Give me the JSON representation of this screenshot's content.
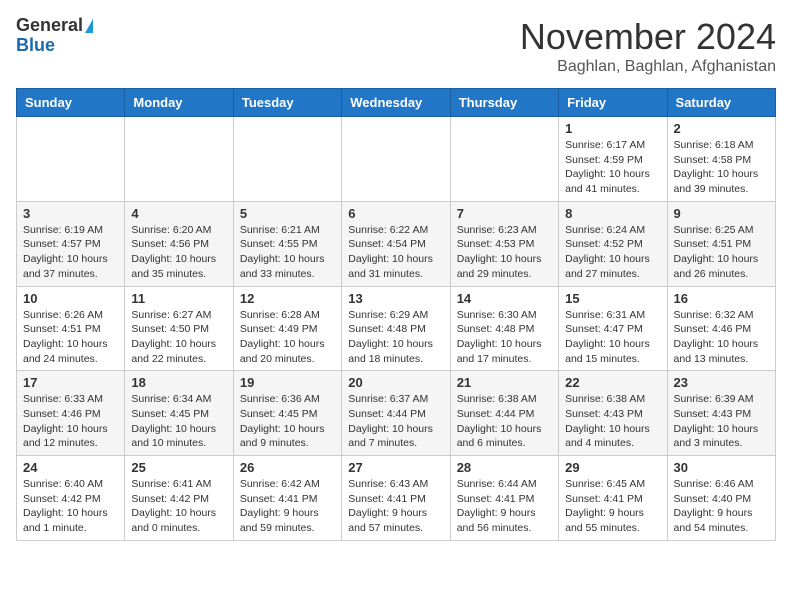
{
  "header": {
    "logo_general": "General",
    "logo_blue": "Blue",
    "month_title": "November 2024",
    "location": "Baghlan, Baghlan, Afghanistan"
  },
  "weekdays": [
    "Sunday",
    "Monday",
    "Tuesday",
    "Wednesday",
    "Thursday",
    "Friday",
    "Saturday"
  ],
  "weeks": [
    [
      {
        "day": "",
        "info": ""
      },
      {
        "day": "",
        "info": ""
      },
      {
        "day": "",
        "info": ""
      },
      {
        "day": "",
        "info": ""
      },
      {
        "day": "",
        "info": ""
      },
      {
        "day": "1",
        "info": "Sunrise: 6:17 AM\nSunset: 4:59 PM\nDaylight: 10 hours and 41 minutes."
      },
      {
        "day": "2",
        "info": "Sunrise: 6:18 AM\nSunset: 4:58 PM\nDaylight: 10 hours and 39 minutes."
      }
    ],
    [
      {
        "day": "3",
        "info": "Sunrise: 6:19 AM\nSunset: 4:57 PM\nDaylight: 10 hours and 37 minutes."
      },
      {
        "day": "4",
        "info": "Sunrise: 6:20 AM\nSunset: 4:56 PM\nDaylight: 10 hours and 35 minutes."
      },
      {
        "day": "5",
        "info": "Sunrise: 6:21 AM\nSunset: 4:55 PM\nDaylight: 10 hours and 33 minutes."
      },
      {
        "day": "6",
        "info": "Sunrise: 6:22 AM\nSunset: 4:54 PM\nDaylight: 10 hours and 31 minutes."
      },
      {
        "day": "7",
        "info": "Sunrise: 6:23 AM\nSunset: 4:53 PM\nDaylight: 10 hours and 29 minutes."
      },
      {
        "day": "8",
        "info": "Sunrise: 6:24 AM\nSunset: 4:52 PM\nDaylight: 10 hours and 27 minutes."
      },
      {
        "day": "9",
        "info": "Sunrise: 6:25 AM\nSunset: 4:51 PM\nDaylight: 10 hours and 26 minutes."
      }
    ],
    [
      {
        "day": "10",
        "info": "Sunrise: 6:26 AM\nSunset: 4:51 PM\nDaylight: 10 hours and 24 minutes."
      },
      {
        "day": "11",
        "info": "Sunrise: 6:27 AM\nSunset: 4:50 PM\nDaylight: 10 hours and 22 minutes."
      },
      {
        "day": "12",
        "info": "Sunrise: 6:28 AM\nSunset: 4:49 PM\nDaylight: 10 hours and 20 minutes."
      },
      {
        "day": "13",
        "info": "Sunrise: 6:29 AM\nSunset: 4:48 PM\nDaylight: 10 hours and 18 minutes."
      },
      {
        "day": "14",
        "info": "Sunrise: 6:30 AM\nSunset: 4:48 PM\nDaylight: 10 hours and 17 minutes."
      },
      {
        "day": "15",
        "info": "Sunrise: 6:31 AM\nSunset: 4:47 PM\nDaylight: 10 hours and 15 minutes."
      },
      {
        "day": "16",
        "info": "Sunrise: 6:32 AM\nSunset: 4:46 PM\nDaylight: 10 hours and 13 minutes."
      }
    ],
    [
      {
        "day": "17",
        "info": "Sunrise: 6:33 AM\nSunset: 4:46 PM\nDaylight: 10 hours and 12 minutes."
      },
      {
        "day": "18",
        "info": "Sunrise: 6:34 AM\nSunset: 4:45 PM\nDaylight: 10 hours and 10 minutes."
      },
      {
        "day": "19",
        "info": "Sunrise: 6:36 AM\nSunset: 4:45 PM\nDaylight: 10 hours and 9 minutes."
      },
      {
        "day": "20",
        "info": "Sunrise: 6:37 AM\nSunset: 4:44 PM\nDaylight: 10 hours and 7 minutes."
      },
      {
        "day": "21",
        "info": "Sunrise: 6:38 AM\nSunset: 4:44 PM\nDaylight: 10 hours and 6 minutes."
      },
      {
        "day": "22",
        "info": "Sunrise: 6:38 AM\nSunset: 4:43 PM\nDaylight: 10 hours and 4 minutes."
      },
      {
        "day": "23",
        "info": "Sunrise: 6:39 AM\nSunset: 4:43 PM\nDaylight: 10 hours and 3 minutes."
      }
    ],
    [
      {
        "day": "24",
        "info": "Sunrise: 6:40 AM\nSunset: 4:42 PM\nDaylight: 10 hours and 1 minute."
      },
      {
        "day": "25",
        "info": "Sunrise: 6:41 AM\nSunset: 4:42 PM\nDaylight: 10 hours and 0 minutes."
      },
      {
        "day": "26",
        "info": "Sunrise: 6:42 AM\nSunset: 4:41 PM\nDaylight: 9 hours and 59 minutes."
      },
      {
        "day": "27",
        "info": "Sunrise: 6:43 AM\nSunset: 4:41 PM\nDaylight: 9 hours and 57 minutes."
      },
      {
        "day": "28",
        "info": "Sunrise: 6:44 AM\nSunset: 4:41 PM\nDaylight: 9 hours and 56 minutes."
      },
      {
        "day": "29",
        "info": "Sunrise: 6:45 AM\nSunset: 4:41 PM\nDaylight: 9 hours and 55 minutes."
      },
      {
        "day": "30",
        "info": "Sunrise: 6:46 AM\nSunset: 4:40 PM\nDaylight: 9 hours and 54 minutes."
      }
    ]
  ]
}
